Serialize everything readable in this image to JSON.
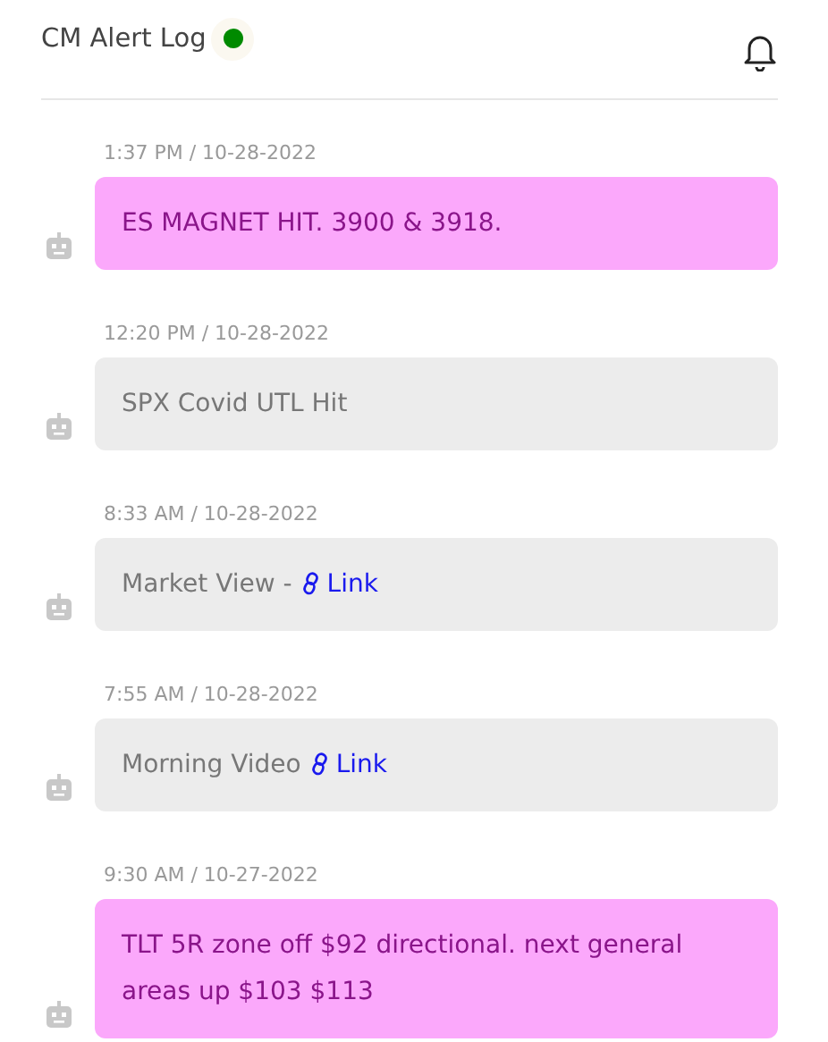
{
  "header": {
    "title": "CM Alert Log",
    "status_dot": {
      "color": "#008a00"
    }
  },
  "messages": [
    {
      "time": "1:37 PM / 10-28-2022",
      "kind": "highlight",
      "text": "ES MAGNET HIT. 3900 & 3918."
    },
    {
      "time": "12:20 PM / 10-28-2022",
      "kind": "plain",
      "text": "SPX Covid UTL Hit"
    },
    {
      "time": "8:33 AM / 10-28-2022",
      "kind": "plain",
      "text": "Market View -",
      "link": "Link"
    },
    {
      "time": "7:55 AM / 10-28-2022",
      "kind": "plain",
      "text": "Morning Video",
      "link": "Link"
    },
    {
      "time": "9:30 AM / 10-27-2022",
      "kind": "highlight",
      "text": "TLT 5R zone off $92 directional. next general areas up $103 $113"
    }
  ]
}
